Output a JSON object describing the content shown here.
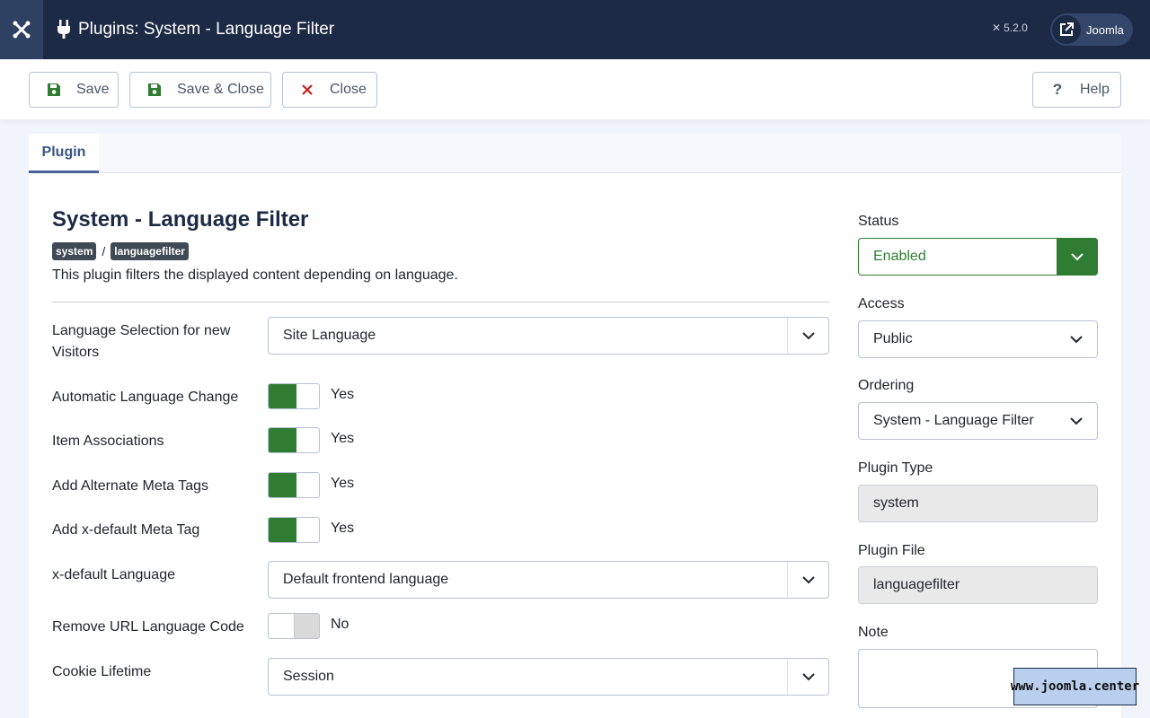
{
  "header": {
    "title": "Plugins: System - Language Filter",
    "version": "5.2.0",
    "site_link_label": "Joomla",
    "icons": {
      "logo": "joomla-logo-icon",
      "plugin": "plug-icon",
      "external": "external-link-icon"
    }
  },
  "toolbar": {
    "save_label": "Save",
    "save_close_label": "Save & Close",
    "close_label": "Close",
    "help_label": "Help",
    "colors": {
      "save_icon": "#2e7d32",
      "close_icon": "#c5221f",
      "help_icon": "#4a5566"
    }
  },
  "tabs": [
    {
      "label": "Plugin",
      "active": true
    }
  ],
  "plugin": {
    "name": "System - Language Filter",
    "folder_badge": "system",
    "element_badge": "languagefilter",
    "separator": "/",
    "description": "This plugin filters the displayed content depending on language."
  },
  "fields": {
    "language_selection": {
      "label": "Language Selection for new Visitors",
      "value": "Site Language"
    },
    "automatic_change": {
      "label": "Automatic Language Change",
      "value": "Yes",
      "on": true
    },
    "item_associations": {
      "label": "Item Associations",
      "value": "Yes",
      "on": true
    },
    "alternate_meta": {
      "label": "Add Alternate Meta Tags",
      "value": "Yes",
      "on": true
    },
    "xdefault_meta": {
      "label": "Add x-default Meta Tag",
      "value": "Yes",
      "on": true
    },
    "xdefault_language": {
      "label": "x-default Language",
      "value": "Default frontend language"
    },
    "remove_url_code": {
      "label": "Remove URL Language Code",
      "value": "No",
      "on": false
    },
    "cookie_lifetime": {
      "label": "Cookie Lifetime",
      "value": "Session"
    }
  },
  "sidebar": {
    "status": {
      "label": "Status",
      "value": "Enabled",
      "color": "#2e7d32"
    },
    "access": {
      "label": "Access",
      "value": "Public"
    },
    "ordering": {
      "label": "Ordering",
      "value": "System - Language Filter"
    },
    "plugin_type": {
      "label": "Plugin Type",
      "value": "system"
    },
    "plugin_file": {
      "label": "Plugin File",
      "value": "languagefilter"
    },
    "note": {
      "label": "Note",
      "value": ""
    }
  },
  "watermark": "www.joomla.center"
}
